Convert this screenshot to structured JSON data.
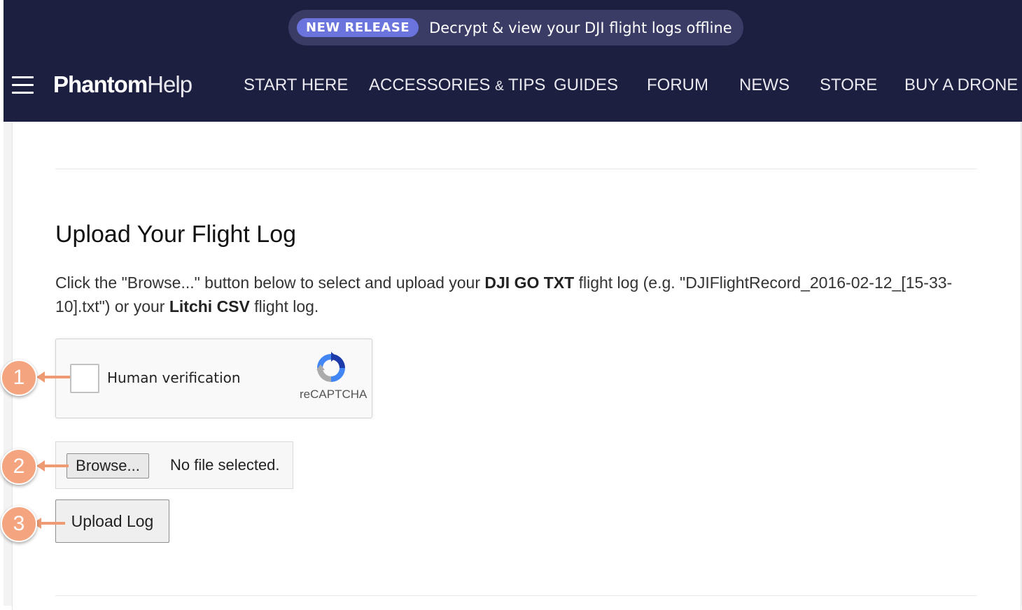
{
  "banner": {
    "badge": "NEW RELEASE",
    "text": "Decrypt & view your DJI flight logs offline"
  },
  "logo": {
    "part1": "Phantom",
    "part2": "Help"
  },
  "nav": {
    "start_here": "START HERE",
    "accessories": "ACCESSORIES",
    "accessories_amp": "&",
    "accessories_tips": "TIPS",
    "guides": "GUIDES",
    "forum": "FORUM",
    "news": "NEWS",
    "store": "STORE",
    "buy_drone": "BUY A DRONE"
  },
  "main": {
    "title": "Upload Your Flight Log",
    "intro": {
      "p1": "Click the \"Browse...\" button below to select and upload your ",
      "b1": "DJI GO TXT",
      "p2": " flight log (e.g. \"DJIFlightRecord_2016-02-12_[15-33-10].txt\") or your ",
      "b2": "Litchi CSV",
      "p3": " flight log."
    },
    "captcha": {
      "label": "Human verification",
      "brand": "reCAPTCHA",
      "checked": false
    },
    "file": {
      "browse_label": "Browse...",
      "status": "No file selected."
    },
    "upload_label": "Upload Log"
  },
  "callouts": [
    "1",
    "2",
    "3"
  ],
  "colors": {
    "header_bg": "#1d1f40",
    "pill_bg": "#3a3c66",
    "badge_bg": "#6b73dc",
    "callout": "#f4a57f"
  },
  "icons": {
    "menu": "hamburger-menu-icon",
    "captcha": "recaptcha-logo-icon"
  }
}
